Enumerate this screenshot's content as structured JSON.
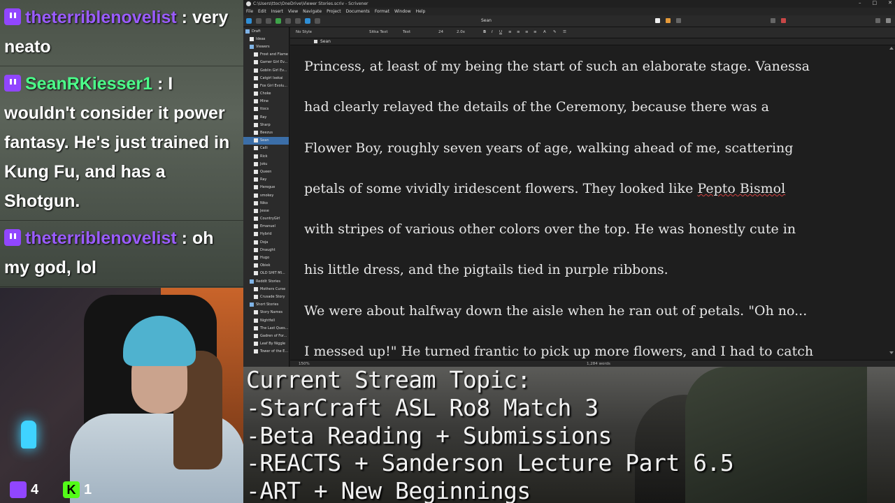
{
  "chat": {
    "messages": [
      {
        "user": "theterriblenovelist",
        "text": " : very neato"
      },
      {
        "user": "SeanRKiesser1",
        "text": " : I wouldn't consider it power fantasy. He's just trained in Kung Fu, and has a Shotgun."
      },
      {
        "user": "theterriblenovelist",
        "text": " : oh my god, lol"
      }
    ]
  },
  "counters": {
    "twitch": "4",
    "kick": "1",
    "kick_letter": "K"
  },
  "scrivener": {
    "window_title": "C:\\Users\\ttoc\\OneDrive\\Viewer Stories.scriv - Scrivener",
    "menus": [
      "File",
      "Edit",
      "Insert",
      "View",
      "Navigate",
      "Project",
      "Documents",
      "Format",
      "Window",
      "Help"
    ],
    "document_title": "Sean",
    "binder": [
      {
        "label": "Draft",
        "type": "folder",
        "indent": 0
      },
      {
        "label": "Ideas",
        "type": "doc",
        "indent": 1
      },
      {
        "label": "Viewers",
        "type": "folder",
        "indent": 1
      },
      {
        "label": "Frost and Flame",
        "type": "doc",
        "indent": 2
      },
      {
        "label": "Gamer Girl Ev...",
        "type": "doc",
        "indent": 2
      },
      {
        "label": "Goblin Girl Ev...",
        "type": "doc",
        "indent": 2
      },
      {
        "label": "Catgirl Isekai",
        "type": "doc",
        "indent": 2
      },
      {
        "label": "Fox Girl Evolu...",
        "type": "doc",
        "indent": 2
      },
      {
        "label": "Choke",
        "type": "doc",
        "indent": 2
      },
      {
        "label": "Mine",
        "type": "doc",
        "indent": 2
      },
      {
        "label": "ttocs",
        "type": "doc",
        "indent": 2
      },
      {
        "label": "Ray",
        "type": "doc",
        "indent": 2
      },
      {
        "label": "Sharp",
        "type": "doc",
        "indent": 2
      },
      {
        "label": "Beezus",
        "type": "doc",
        "indent": 2
      },
      {
        "label": "Sean",
        "type": "doc",
        "indent": 2,
        "selected": true
      },
      {
        "label": "Calli",
        "type": "doc",
        "indent": 2
      },
      {
        "label": "Rick",
        "type": "doc",
        "indent": 2
      },
      {
        "label": "Joku",
        "type": "doc",
        "indent": 2
      },
      {
        "label": "Queen",
        "type": "doc",
        "indent": 2
      },
      {
        "label": "Ray",
        "type": "doc",
        "indent": 2
      },
      {
        "label": "Heregue",
        "type": "doc",
        "indent": 2
      },
      {
        "label": "smokey",
        "type": "doc",
        "indent": 2
      },
      {
        "label": "Niko",
        "type": "doc",
        "indent": 2
      },
      {
        "label": "Jesse",
        "type": "doc",
        "indent": 2
      },
      {
        "label": "CountryGirl",
        "type": "doc",
        "indent": 2
      },
      {
        "label": "Emanuel",
        "type": "doc",
        "indent": 2
      },
      {
        "label": "Hybrid",
        "type": "doc",
        "indent": 2
      },
      {
        "label": "Doja",
        "type": "doc",
        "indent": 2
      },
      {
        "label": "Dnaught",
        "type": "doc",
        "indent": 2
      },
      {
        "label": "Hugo",
        "type": "doc",
        "indent": 2
      },
      {
        "label": "Obiek",
        "type": "doc",
        "indent": 2
      },
      {
        "label": "OLD SHIT MI...",
        "type": "doc",
        "indent": 2
      },
      {
        "label": "Reddit Stories",
        "type": "folder",
        "indent": 1
      },
      {
        "label": "Mothers Curse",
        "type": "doc",
        "indent": 2
      },
      {
        "label": "Crusade Story",
        "type": "doc",
        "indent": 2
      },
      {
        "label": "Short Stories",
        "type": "folder",
        "indent": 1
      },
      {
        "label": "Story Names",
        "type": "doc",
        "indent": 2
      },
      {
        "label": "Nightfell",
        "type": "doc",
        "indent": 2
      },
      {
        "label": "The Last Ques...",
        "type": "doc",
        "indent": 2
      },
      {
        "label": "Gadren of For...",
        "type": "doc",
        "indent": 2
      },
      {
        "label": "Leaf By Niggle",
        "type": "doc",
        "indent": 2
      },
      {
        "label": "Tower of the E...",
        "type": "doc",
        "indent": 2
      }
    ],
    "format": {
      "style": "No Style",
      "font": "Sitka Text",
      "face": "Text",
      "size": "24",
      "line_spacing": "2.0x"
    },
    "header": "Sean",
    "paragraph_lines": [
      "Princess, at least of my being the start of such an elaborate stage. Vanessa",
      "had clearly relayed the details of the Ceremony, because there was a",
      "Flower Boy, roughly seven years of age, walking ahead of me, scattering",
      "petals of some vividly iridescent flowers. They looked like ",
      "with stripes of various other colors over the top. He was honestly cute in",
      "his little dress, and the pigtails tied in purple ribbons.",
      "We were about halfway down the aisle when he ran out of petals. \"Oh no...",
      "I messed up!\" He turned frantic to pick up more flowers, and I had to catch"
    ],
    "misspelled": "Pepto Bismol",
    "zoom": "150%",
    "word_count": "1,284 words"
  },
  "topic": {
    "lines": [
      "Current Stream Topic:",
      "-StarCraft ASL Ro8 Match 3",
      "-Beta Reading + Submissions",
      "-REACTS + Sanderson Lecture Part 6.5",
      "-ART + New Beginnings"
    ]
  }
}
